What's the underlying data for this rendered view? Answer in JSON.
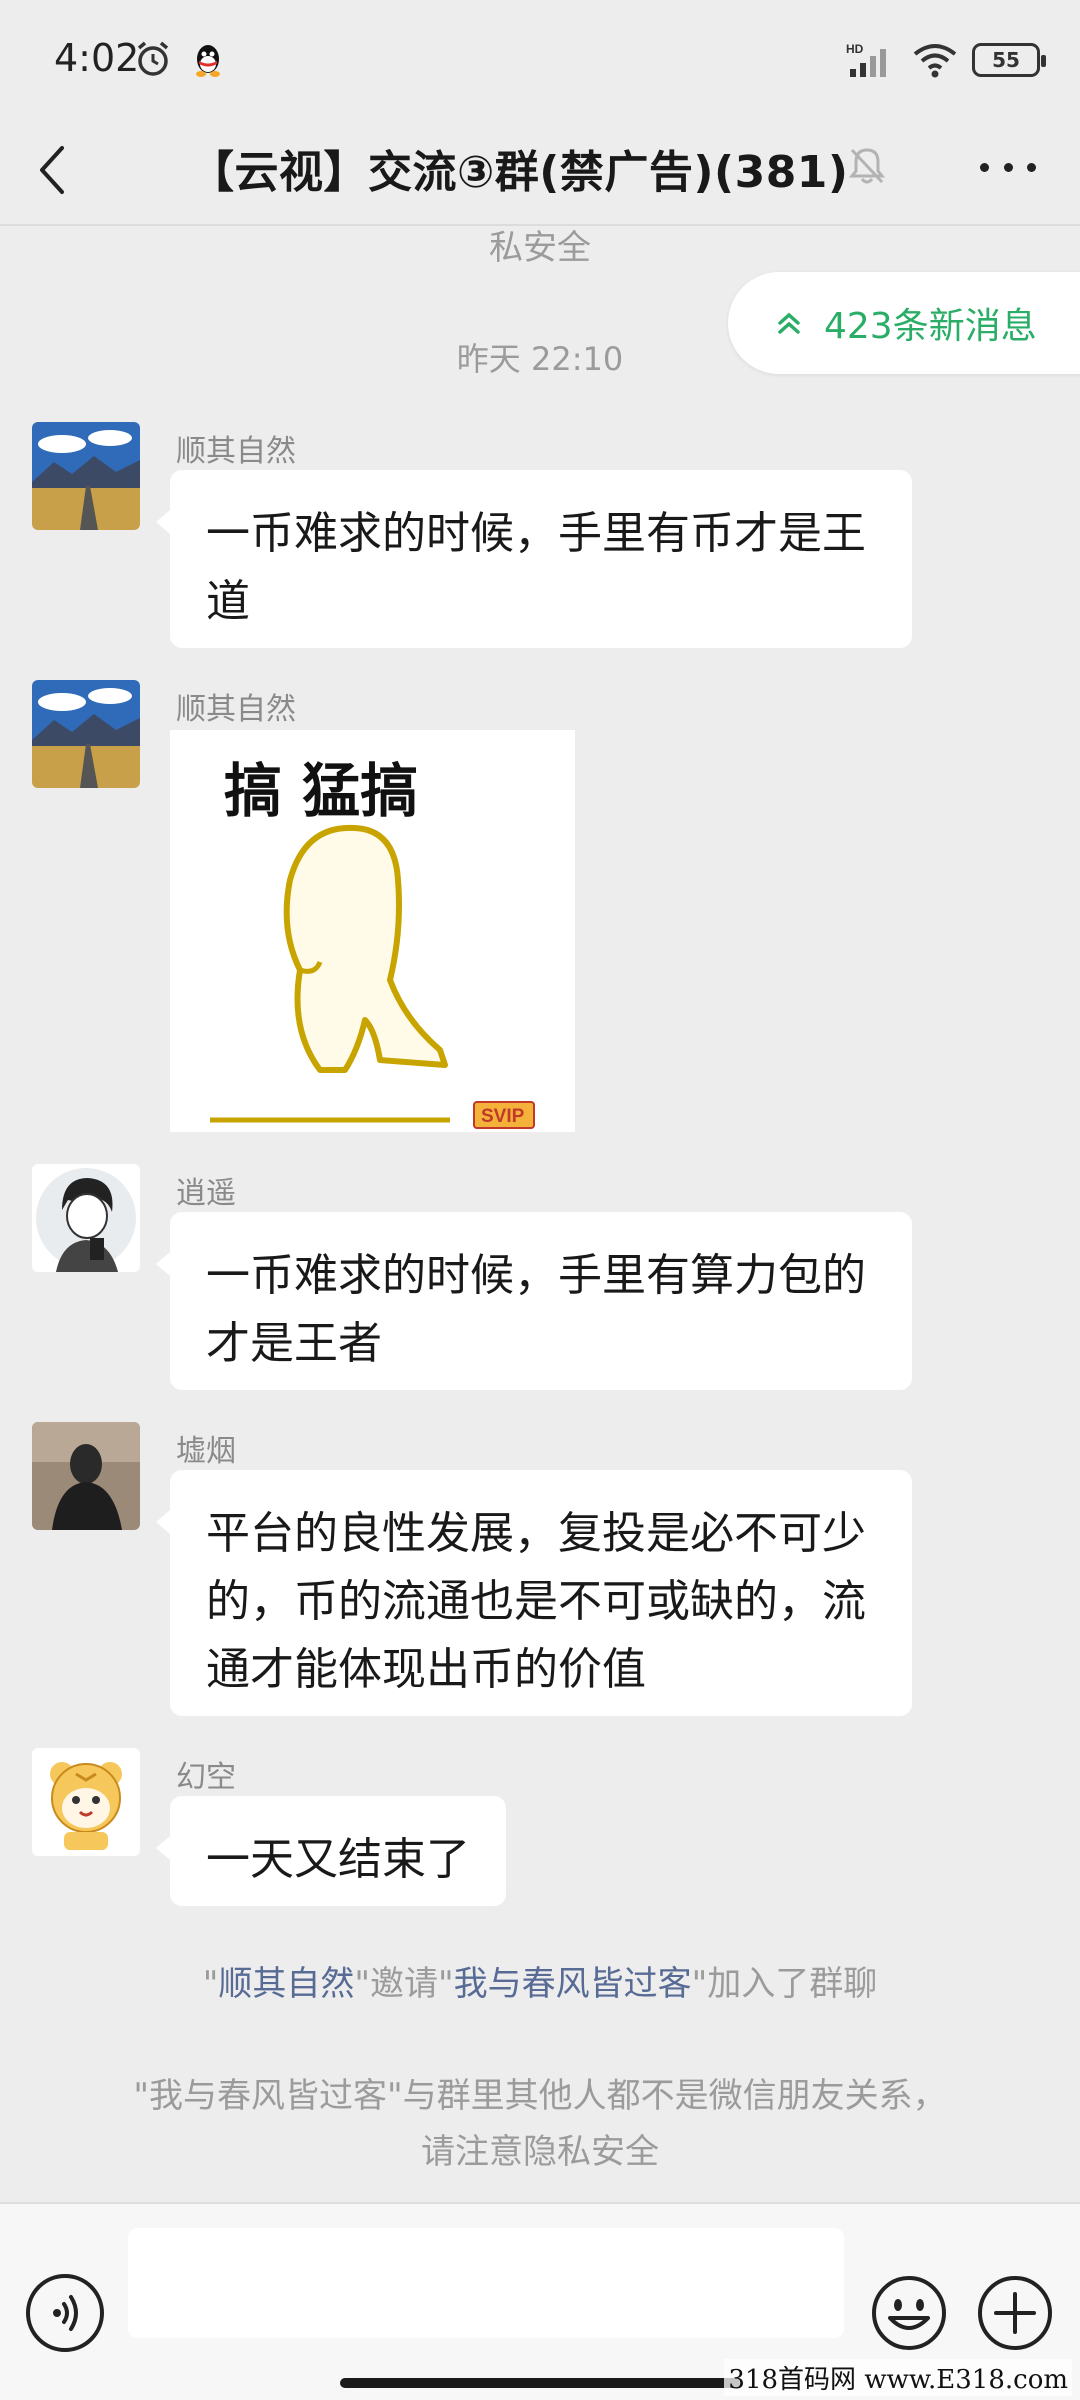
{
  "status_bar": {
    "time": "4:02",
    "network": "HD",
    "battery": "55"
  },
  "header": {
    "title": "【云视】交流③群(禁广告)(381)"
  },
  "system": {
    "top_fragment": "私安全",
    "timestamp": "昨天 22:10"
  },
  "new_messages": {
    "label": "423条新消息"
  },
  "messages": [
    {
      "sender": "顺其自然",
      "text_line1": "一币难求的时候，手里有币才是王",
      "text_line2": "道"
    },
    {
      "sender": "顺其自然",
      "sticker_caption": "搞 猛搞",
      "sticker_badge": "SVIP"
    },
    {
      "sender": "逍遥",
      "text_line1": "一币难求的时候，手里有算力包的",
      "text_line2": "才是王者"
    },
    {
      "sender": "墟烟",
      "text_line1": "平台的良性发展，复投是必不可少",
      "text_line2": "的，币的流通也是不可或缺的，流",
      "text_line3": "通才能体现出币的价值"
    },
    {
      "sender": "幻空",
      "text_line1": "一天又结束了"
    }
  ],
  "invite_notice": {
    "q1": "\"",
    "inviter": "顺其自然",
    "q2": "\"邀请\"",
    "invitee": "我与春风皆过客",
    "q3": "\"加入了群聊"
  },
  "privacy_notice": {
    "line1": "\"我与春风皆过客\"与群里其他人都不是微信朋友关系，",
    "line2": "请注意隐私安全"
  },
  "input": {
    "placeholder": ""
  },
  "watermark": "318首码网 www.E318.com",
  "colors": {
    "background": "#ededed",
    "bubble": "#ffffff",
    "accent_green": "#2aae67",
    "link_blue": "#576b95"
  }
}
